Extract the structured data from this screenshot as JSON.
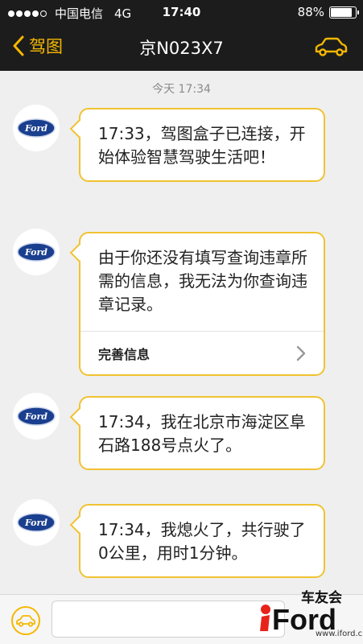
{
  "status_bar": {
    "signal_dots": 5,
    "signal_filled": 4,
    "carrier": "中国电信",
    "network": "4G",
    "time": "17:40",
    "battery_text": "88%",
    "battery_level": 0.88
  },
  "nav": {
    "back_label": "驾图",
    "title": "京N023X7",
    "right_icon": "car-icon",
    "accent_color": "#f5b800"
  },
  "chat": {
    "timestamp": "今天 17:34",
    "messages": [
      {
        "text": "17:33，驾图盒子已连接，开始体验智慧驾驶生活吧！",
        "avatar": "Ford"
      },
      {
        "text": "由于你还没有填写查询违章所需的信息，我无法为你查询违章记录。",
        "action": "完善信息",
        "avatar": "Ford"
      },
      {
        "text": "17:34，我在北京市海淀区阜石路188号点火了。",
        "avatar": "Ford"
      },
      {
        "text": "17:34，我熄火了，共行驶了0公里，用时1分钟。",
        "avatar": "Ford"
      }
    ]
  },
  "input_bar": {
    "value": "",
    "left_icon": "car-icon"
  },
  "watermark": {
    "brand_cn": "车友会",
    "logo": "iFord",
    "url": "www.iford.cn"
  }
}
